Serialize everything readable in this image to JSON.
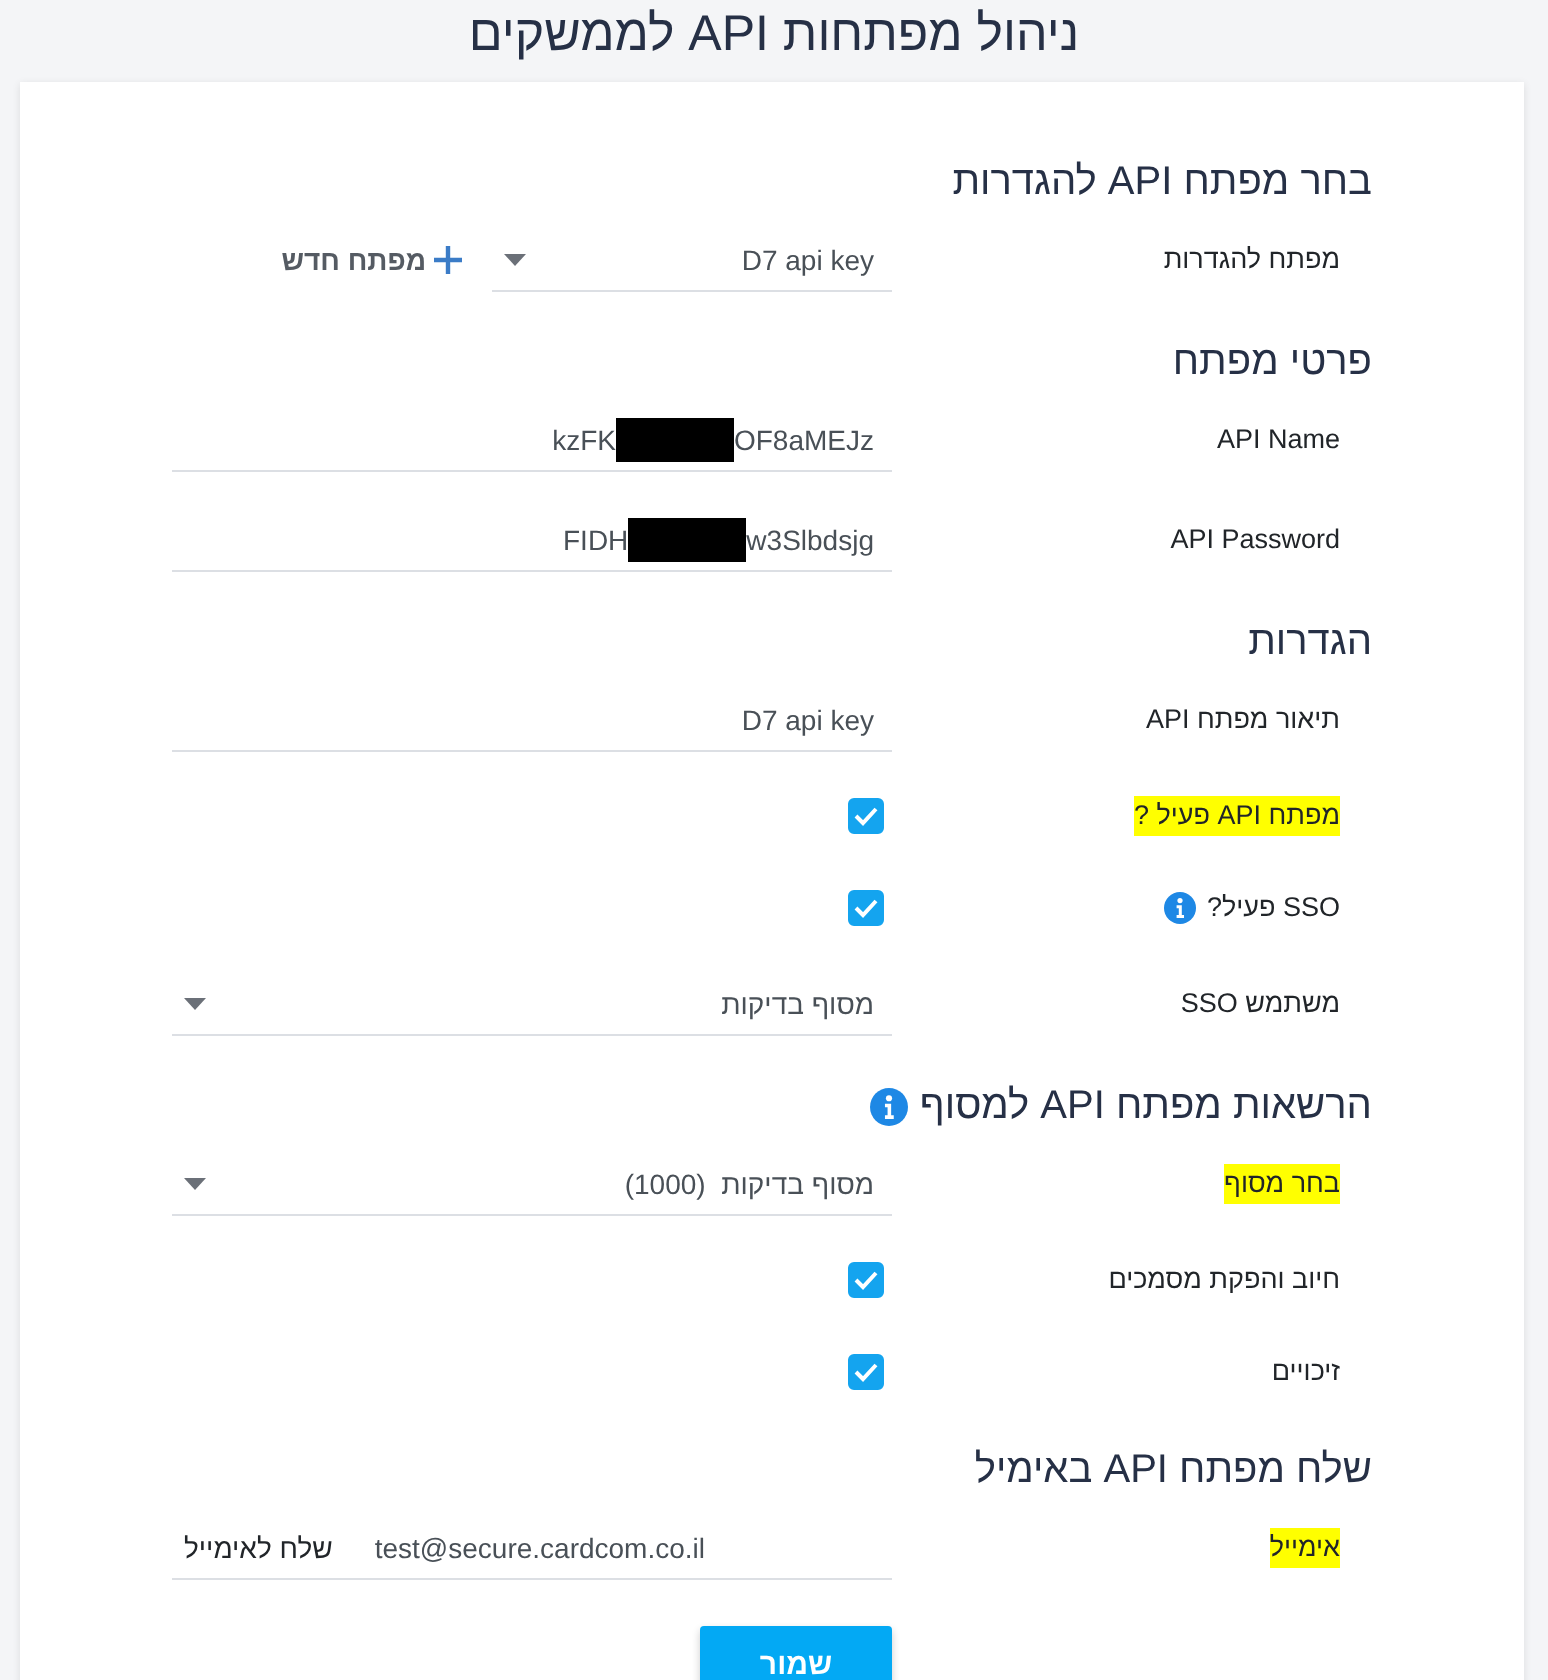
{
  "title": "ניהול מפתחות API לממשקים",
  "sections": [
    {
      "heading": "בחר מפתח API להגדרות",
      "info": false,
      "rows": [
        {
          "kind": "select",
          "label": "מפתח להגדרות",
          "highlighted": false,
          "info": false,
          "value": "D7 api key",
          "action": "מפתח חדש"
        }
      ]
    },
    {
      "heading": "פרטי מפתח",
      "info": false,
      "rows": [
        {
          "kind": "redacted",
          "label": "API Name",
          "highlighted": false,
          "info": false,
          "value_start": "kzFK",
          "value_end": "OF8aMEJz"
        },
        {
          "kind": "redacted",
          "label": "API Password",
          "highlighted": false,
          "info": false,
          "value_start": "FIDH",
          "value_end": "w3Slbdsjg"
        }
      ]
    },
    {
      "heading": "הגדרות",
      "info": false,
      "rows": [
        {
          "kind": "text",
          "label": "תיאור מפתח API",
          "highlighted": false,
          "info": false,
          "value": "D7 api key"
        },
        {
          "kind": "checkbox",
          "label": "מפתח API פעיל ?",
          "highlighted": true,
          "info": false,
          "checked": true
        },
        {
          "kind": "checkbox",
          "label": "SSO פעיל?",
          "highlighted": false,
          "info": true,
          "checked": true
        },
        {
          "kind": "select",
          "label": "משתמש SSO",
          "highlighted": false,
          "info": false,
          "value": "מסוף בדיקות"
        }
      ]
    },
    {
      "heading": "הרשאות מפתח API למסוף",
      "info": true,
      "rows": [
        {
          "kind": "select",
          "label": "בחר מסוף",
          "highlighted": true,
          "info": false,
          "value": "מסוף בדיקות  (1000)"
        },
        {
          "kind": "checkbox",
          "label": "חיוב והפקת מסמכים",
          "highlighted": false,
          "info": false,
          "checked": true
        },
        {
          "kind": "checkbox",
          "label": "זיכויים",
          "highlighted": false,
          "info": false,
          "checked": true
        }
      ]
    },
    {
      "heading": "שלח מפתח API באימיל",
      "info": false,
      "rows": [
        {
          "kind": "text",
          "label": "אימייל",
          "highlighted": true,
          "info": false,
          "value": "test@secure.cardcom.co.il",
          "suffix": "שלח לאימייל"
        }
      ]
    }
  ],
  "save_button": {
    "label": "שמור"
  }
}
